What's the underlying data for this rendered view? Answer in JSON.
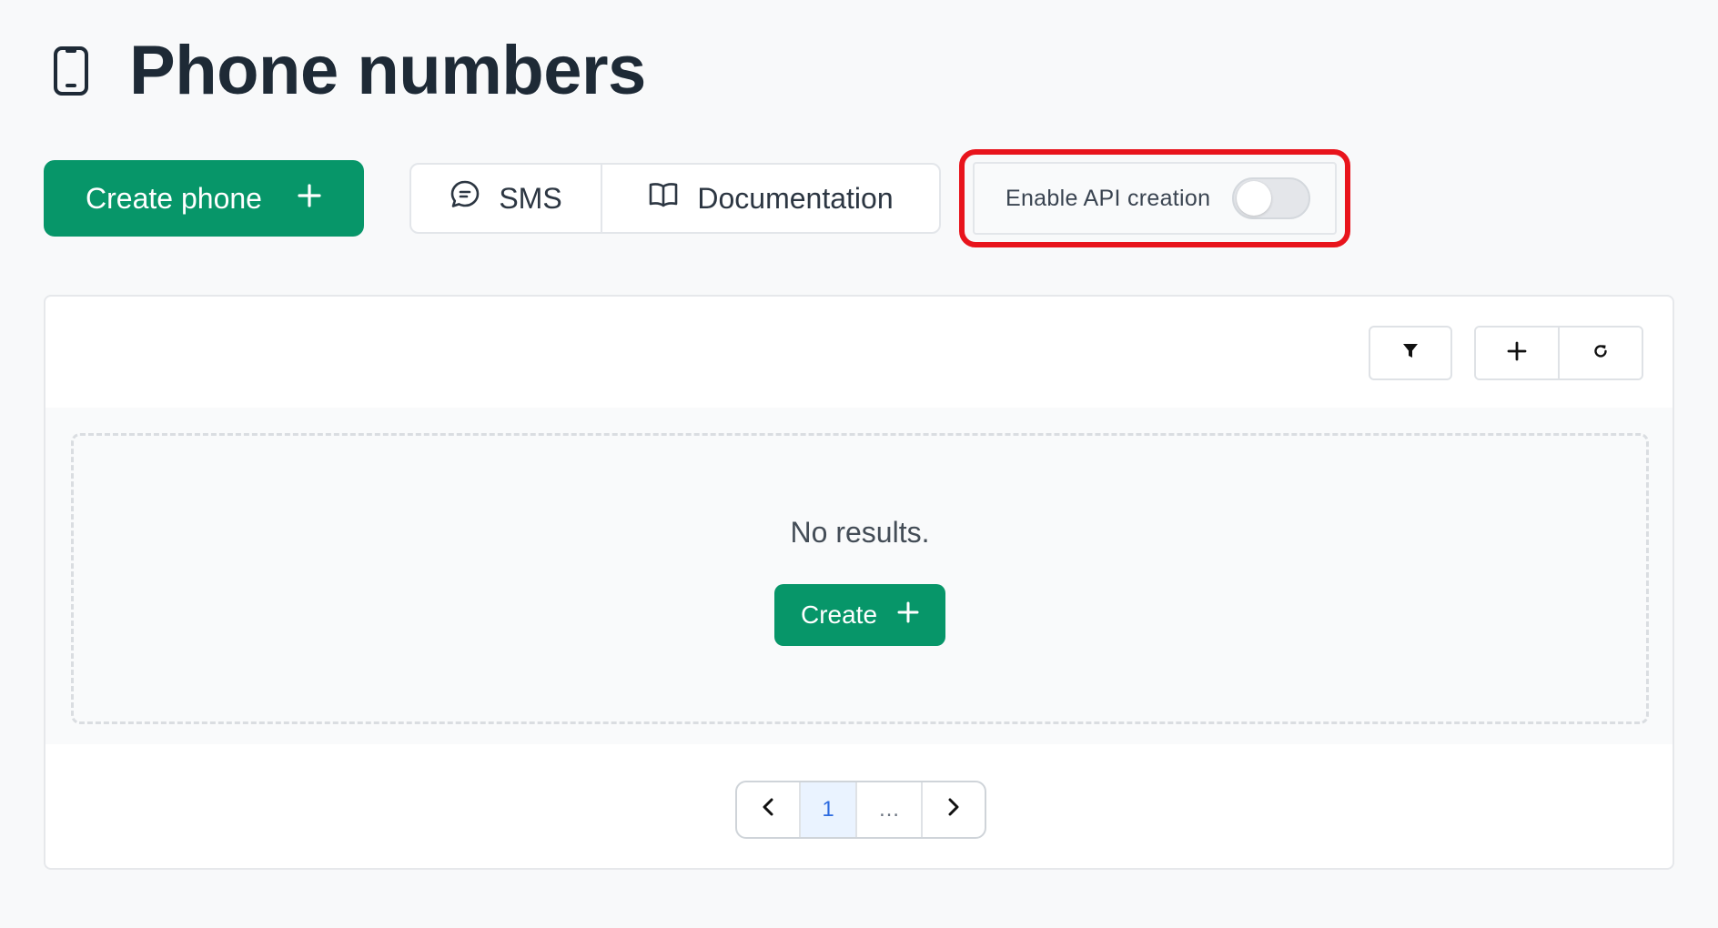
{
  "page": {
    "title": "Phone numbers",
    "title_icon": "phone-icon"
  },
  "toolbar": {
    "create_phone_label": "Create phone",
    "create_phone_icon": "plus-icon",
    "sms_label": "SMS",
    "sms_icon": "chat-bubble-icon",
    "documentation_label": "Documentation",
    "documentation_icon": "book-icon",
    "api_toggle_label": "Enable API creation",
    "api_toggle_on": false
  },
  "table": {
    "tools": [
      "filter-icon",
      "plus-icon",
      "refresh-icon"
    ],
    "empty_message": "No results.",
    "create_label": "Create",
    "create_icon": "plus-icon"
  },
  "pagination": {
    "current_page": "1",
    "ellipsis": "…"
  },
  "colors": {
    "primary": "#079669",
    "highlight": "#e8141c",
    "active_page_bg": "#eaf3ff",
    "active_page_text": "#2d6be0"
  }
}
